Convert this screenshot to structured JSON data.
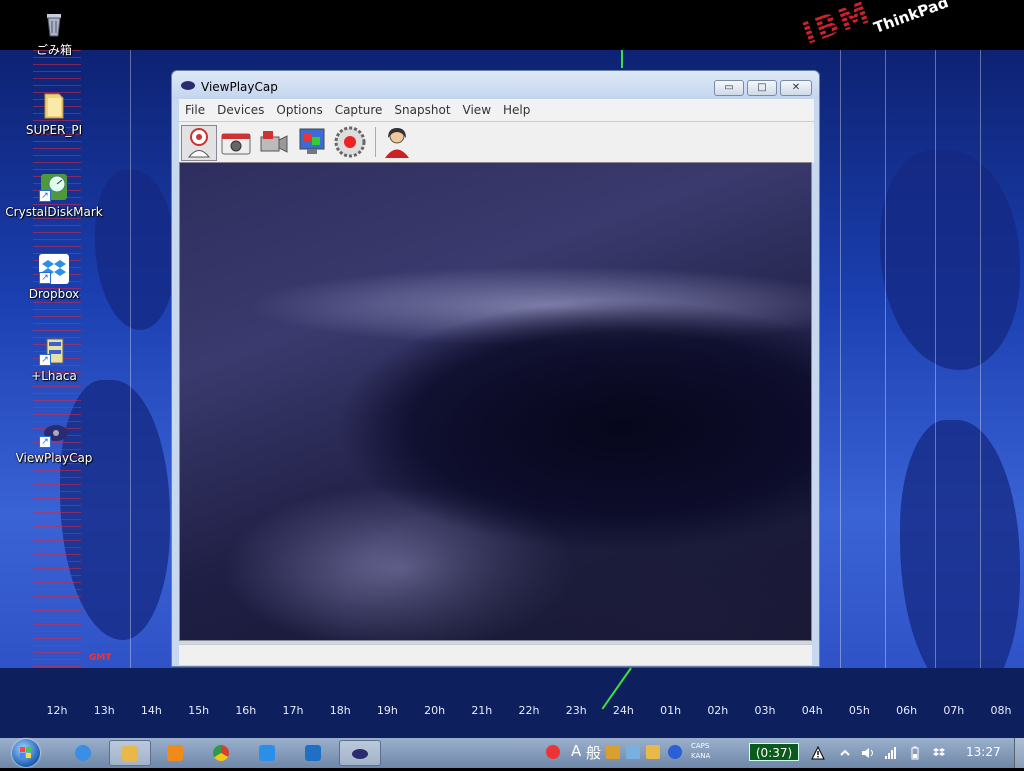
{
  "desktop": {
    "icons": [
      {
        "label": "ごみ箱",
        "icon": "recycle-bin-icon"
      },
      {
        "label": "SUPER_PI",
        "icon": "folder-icon"
      },
      {
        "label": "CrystalDiskMark",
        "icon": "crystaldiskmark-icon"
      },
      {
        "label": "Dropbox",
        "icon": "dropbox-icon"
      },
      {
        "label": "+Lhaca",
        "icon": "lhaca-icon"
      },
      {
        "label": "ViewPlayCap",
        "icon": "viewplaycap-icon"
      }
    ],
    "wallpaper": {
      "gmt_label": "GMT",
      "hours": [
        "12h",
        "13h",
        "14h",
        "15h",
        "16h",
        "17h",
        "18h",
        "19h",
        "20h",
        "21h",
        "22h",
        "23h",
        "24h",
        "01h",
        "02h",
        "03h",
        "04h",
        "05h",
        "06h",
        "07h",
        "08h"
      ]
    },
    "logo": {
      "ibm": "IBM",
      "brand": "ThinkPad"
    }
  },
  "window": {
    "title": "ViewPlayCap",
    "controls": {
      "minimize": "▭",
      "maximize": "□",
      "close": "✕"
    },
    "menu": [
      "File",
      "Devices",
      "Options",
      "Capture",
      "Snapshot",
      "View",
      "Help"
    ],
    "toolbar": [
      {
        "name": "webcam-preview",
        "icon": "webcam-icon",
        "active": true
      },
      {
        "name": "snapshot",
        "icon": "camera-icon"
      },
      {
        "name": "capture-video",
        "icon": "video-camera-icon"
      },
      {
        "name": "display-settings",
        "icon": "monitor-icon"
      },
      {
        "name": "record",
        "icon": "record-icon"
      },
      {
        "name": "user",
        "icon": "person-icon"
      }
    ]
  },
  "taskbar": {
    "apps": [
      {
        "name": "internet-explorer",
        "icon": "ie-icon",
        "color": "#3a8ee6"
      },
      {
        "name": "explorer",
        "icon": "folder-icon",
        "color": "#e8b84a",
        "active": true
      },
      {
        "name": "media-player",
        "icon": "media-player-icon",
        "color": "#f08a1c"
      },
      {
        "name": "chrome",
        "icon": "chrome-icon",
        "color": "#d9412f"
      },
      {
        "name": "dropbox",
        "icon": "dropbox-icon",
        "color": "#2b8fe8"
      },
      {
        "name": "outlook",
        "icon": "outlook-icon",
        "color": "#1f6fc4"
      },
      {
        "name": "viewplaycap",
        "icon": "viewplaycap-icon",
        "color": "#2b2b70",
        "active": true
      }
    ],
    "ime": {
      "mode": "A",
      "kanji": "般"
    },
    "caps": "CAPS",
    "kana": "KANA",
    "battery": "(0:37)",
    "clock": "13:27"
  }
}
